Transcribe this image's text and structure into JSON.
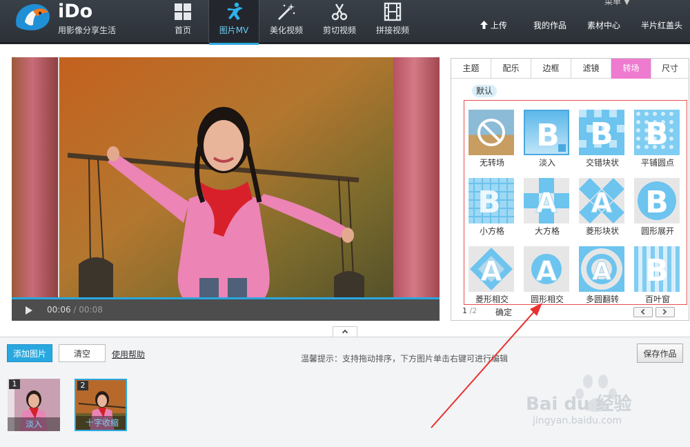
{
  "header": {
    "brand": "iDo",
    "tagline": "用影像分享生活",
    "nav": [
      {
        "label": "首页",
        "icon": "grid-icon"
      },
      {
        "label": "图片MV",
        "icon": "dancer-icon",
        "active": true
      },
      {
        "label": "美化视频",
        "icon": "magic-wand-icon"
      },
      {
        "label": "剪切视频",
        "icon": "scissors-icon"
      },
      {
        "label": "拼接视频",
        "icon": "film-icon"
      }
    ],
    "links": {
      "upload": "上传",
      "my_works": "我的作品",
      "material_center": "素材中心",
      "credits": "半片红盖头"
    },
    "user_truncated": "菜单 ▼"
  },
  "player": {
    "current_time": "00:06",
    "separator": "/",
    "total_time": "00:08",
    "progress": 1.0
  },
  "panel": {
    "tabs": [
      {
        "label": "主题"
      },
      {
        "label": "配乐"
      },
      {
        "label": "边框"
      },
      {
        "label": "滤镜"
      },
      {
        "label": "转场",
        "active": true
      },
      {
        "label": "尺寸"
      }
    ],
    "sub_tab": "默认",
    "transitions": [
      {
        "label": "无转场",
        "icon": "no-transition-icon"
      },
      {
        "label": "淡入",
        "icon": "fade-in-icon",
        "selected": true
      },
      {
        "label": "交错块状",
        "icon": "staggered-blocks-icon"
      },
      {
        "label": "平铺圆点",
        "icon": "tiled-dots-icon"
      },
      {
        "label": "小方格",
        "icon": "small-grid-icon"
      },
      {
        "label": "大方格",
        "icon": "large-grid-icon"
      },
      {
        "label": "菱形块状",
        "icon": "diamond-blocks-icon"
      },
      {
        "label": "圆形展开",
        "icon": "circle-expand-icon"
      },
      {
        "label": "菱形相交",
        "icon": "diamond-intersect-icon"
      },
      {
        "label": "圆形相交",
        "icon": "circle-intersect-icon"
      },
      {
        "label": "多圆翻转",
        "icon": "multi-circle-flip-icon"
      },
      {
        "label": "百叶窗",
        "icon": "blinds-icon"
      }
    ],
    "pager": {
      "current": "1",
      "separator": "/",
      "total": "2"
    },
    "confirm": "确定"
  },
  "bottom": {
    "add_image": "添加图片",
    "clear": "清空",
    "help": "使用帮助",
    "tip": "温馨提示：支持拖动排序，下方图片单击右键可进行编辑",
    "save": "保存作品",
    "slides": [
      {
        "num": "1",
        "label": "淡入"
      },
      {
        "num": "2",
        "label": "十字收缩",
        "active": true
      }
    ]
  },
  "watermark": {
    "main": "Bai du 经验",
    "sub": "jingyan.baidu.com"
  },
  "colors": {
    "accent_blue": "#29a8e0",
    "active_tab_pink": "#ef7bd1",
    "highlight_red": "#e44d4d"
  }
}
